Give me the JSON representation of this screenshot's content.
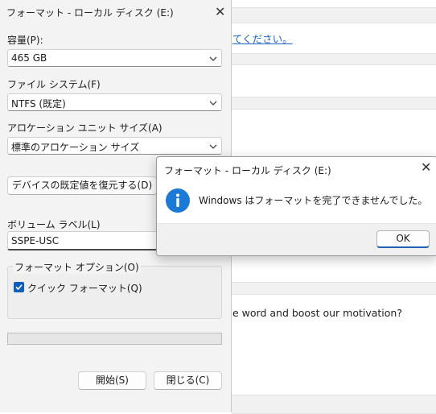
{
  "background_page": {
    "link_text": "てください。",
    "body_text": "e word and boost our motivation?"
  },
  "format_dialog": {
    "title": "フォーマット - ローカル ディスク (E:)",
    "close_icon": "close-icon",
    "capacity": {
      "label": "容量(P):",
      "value": "465 GB"
    },
    "file_system": {
      "label": "ファイル システム(F)",
      "value": "NTFS (既定)"
    },
    "allocation_unit": {
      "label": "アロケーション ユニット サイズ(A)",
      "value": "標準のアロケーション サイズ"
    },
    "restore_defaults_button": "デバイスの既定値を復元する(D)",
    "volume_label": {
      "label": "ボリューム ラベル(L)",
      "value": "SSPE-USC"
    },
    "format_options": {
      "title": "フォーマット オプション(O)",
      "quick_format": {
        "label": "クイック フォーマット(Q)",
        "checked": true
      }
    },
    "progress": 0,
    "start_button": "開始(S)",
    "close_button": "閉じる(C)"
  },
  "message_box": {
    "title": "フォーマット - ローカル ディスク (E:)",
    "message": "Windows はフォーマットを完了できませんでした。",
    "icon": "info-icon",
    "ok_button": "OK"
  },
  "colors": {
    "accent": "#0f5fb8",
    "info_icon": "#1c7ad6",
    "link": "#1a66c2"
  }
}
